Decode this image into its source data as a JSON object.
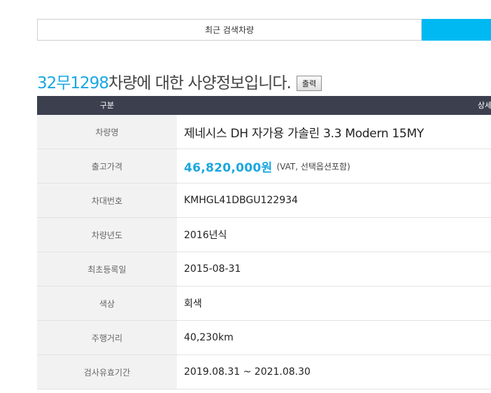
{
  "tabs": {
    "recent_label": "최근 검색차량"
  },
  "header": {
    "plate": "32무1298",
    "title": " 차량에 대한 사양정보입니다.",
    "print_label": "출력"
  },
  "table": {
    "col_left": "구분",
    "col_right": "상세",
    "rows": [
      {
        "label": "차량명",
        "value": "제네시스 DH 자가용 가솔린 3.3 Modern 15MY"
      },
      {
        "label": "출고가격",
        "value": "46,820,000원",
        "note": "(VAT, 선택옵션포함)"
      },
      {
        "label": "차대번호",
        "value": "KMHGL41DBGU122934"
      },
      {
        "label": "차량년도",
        "value": "2016년식"
      },
      {
        "label": "최초등록일",
        "value": "2015-08-31"
      },
      {
        "label": "색상",
        "value": "회색"
      },
      {
        "label": "주행거리",
        "value": "40,230km"
      },
      {
        "label": "검사유효기간",
        "value": "2019.08.31 ~ 2021.08.30"
      }
    ]
  },
  "colors": {
    "accent": "#00b9f2",
    "plate": "#1aa7e0",
    "header_bg": "#3c3f4e"
  }
}
